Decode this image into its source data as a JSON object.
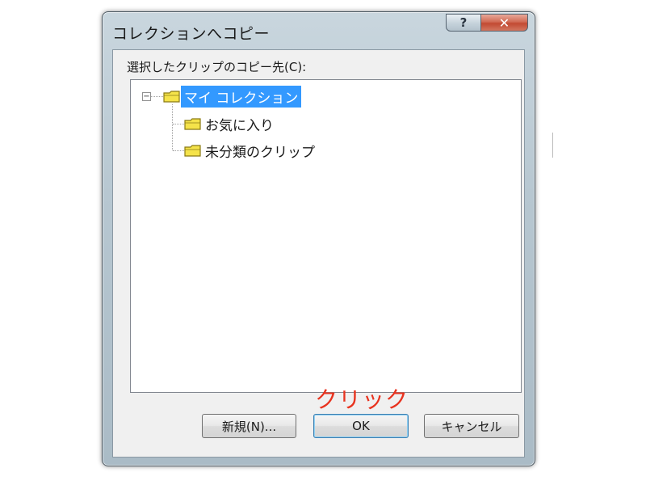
{
  "window": {
    "title": "コレクションへコピー",
    "help_label": "?",
    "close_label": "✕"
  },
  "dialog": {
    "tree_label": "選択したクリップのコピー先(C):",
    "tree": {
      "root": {
        "label": "マイ コレクション",
        "expander": "−",
        "selected": true
      },
      "children": [
        {
          "label": "お気に入り"
        },
        {
          "label": "未分類のクリップ"
        }
      ]
    },
    "annotation": "クリック",
    "buttons": {
      "new_label": "新規(N)...",
      "ok_label": "OK",
      "cancel_label": "キャンセル"
    }
  },
  "colors": {
    "selection": "#3399ff",
    "annotation": "#e8331f",
    "folder_fill": "#f5e34a",
    "folder_stroke": "#8a7a14"
  },
  "icons": {
    "folder": "folder-icon",
    "help": "help-icon",
    "close": "close-icon"
  }
}
